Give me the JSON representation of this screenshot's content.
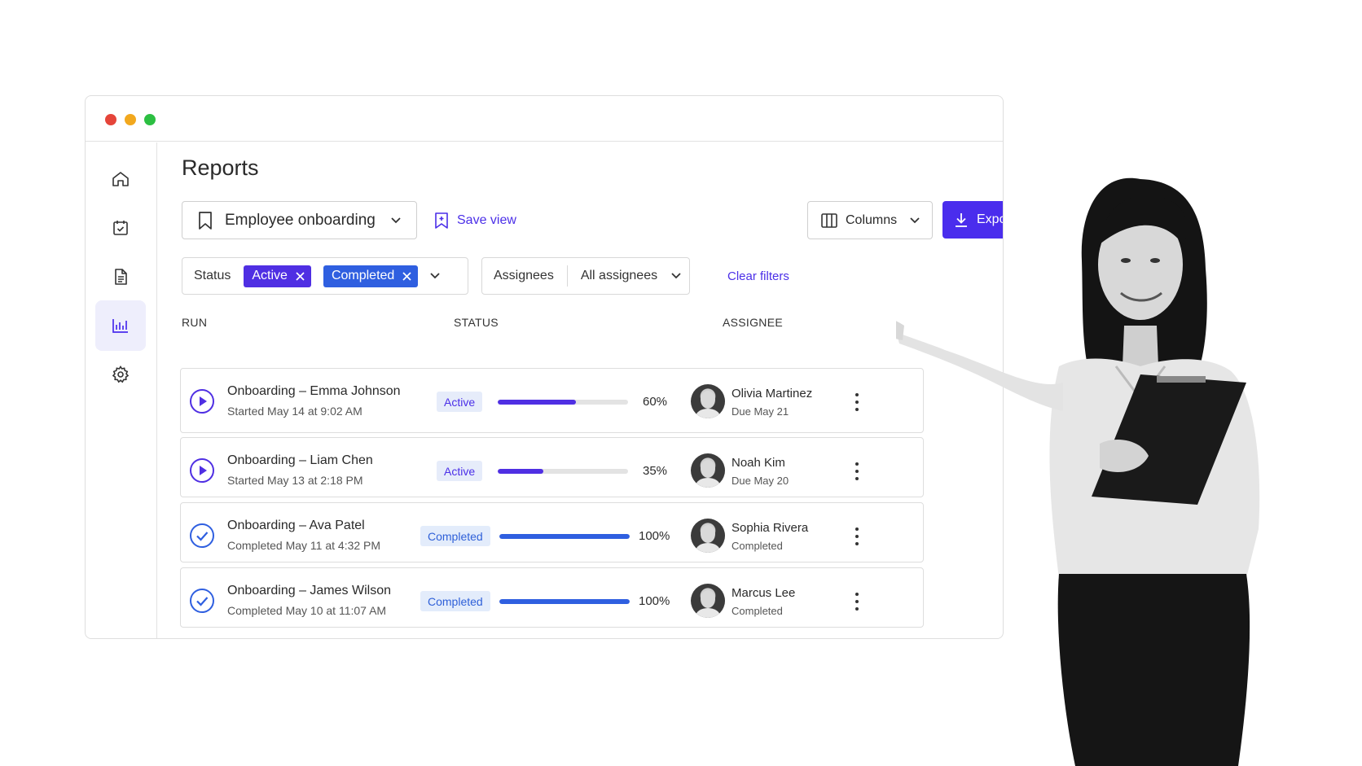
{
  "window": {
    "controls": [
      "close",
      "minimize",
      "maximize"
    ]
  },
  "sidebar": {
    "items": [
      {
        "icon": "home-icon",
        "active": false
      },
      {
        "icon": "task-check-icon",
        "active": false
      },
      {
        "icon": "document-icon",
        "active": false
      },
      {
        "icon": "chart-icon",
        "active": true
      },
      {
        "icon": "gear-icon",
        "active": false
      }
    ]
  },
  "page": {
    "title": "Reports"
  },
  "toolbar": {
    "view_label": "Employee onboarding",
    "save_view_label": "Save view",
    "columns_label": "Columns",
    "export_label": "Export"
  },
  "filters": {
    "status_label": "Status",
    "status_chips": [
      "Active",
      "Completed"
    ],
    "assignees_label": "Assignees",
    "assignees_value": "All assignees",
    "clear_label": "Clear filters"
  },
  "table": {
    "headers": {
      "run": "RUN",
      "status": "STATUS",
      "assignee": "ASSIGNEE"
    },
    "rows": [
      {
        "name": "Onboarding – Emma Johnson",
        "sub": "Started May 14 at 9:02 AM",
        "status": "Active",
        "progress": 60,
        "pct_label": "60%",
        "assignee": "Olivia Martinez",
        "assignee_sub": "Due May 21",
        "icon": "play-icon"
      },
      {
        "name": "Onboarding – Liam Chen",
        "sub": "Started May 13 at 2:18 PM",
        "status": "Active",
        "progress": 35,
        "pct_label": "35%",
        "assignee": "Noah Kim",
        "assignee_sub": "Due May 20",
        "icon": "play-icon"
      },
      {
        "name": "Onboarding – Ava Patel",
        "sub": "Completed May 11 at 4:32 PM",
        "status": "Completed",
        "progress": 100,
        "pct_label": "100%",
        "assignee": "Sophia Rivera",
        "assignee_sub": "Completed",
        "icon": "check-circle-icon"
      },
      {
        "name": "Onboarding – James Wilson",
        "sub": "Completed May 10 at 11:07 AM",
        "status": "Completed",
        "progress": 100,
        "pct_label": "100%",
        "assignee": "Marcus Lee",
        "assignee_sub": "Completed",
        "icon": "check-circle-icon"
      }
    ]
  },
  "colors": {
    "accent": "#4a2ded",
    "active": "#4f2fe3",
    "completed": "#2f5fe0"
  }
}
